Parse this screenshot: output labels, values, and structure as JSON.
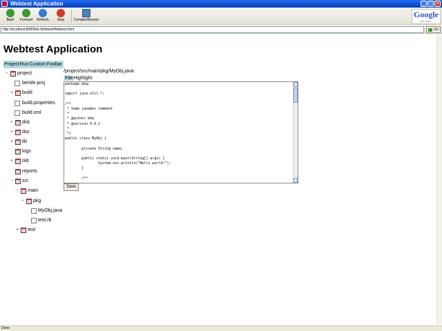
{
  "window": {
    "title": "Webtest Application"
  },
  "toolbar": {
    "back": "Back",
    "forward": "Forward",
    "refresh": "Refresh",
    "stop": "Stop",
    "compile": "Compile/Browse"
  },
  "google": {
    "logo": "Google",
    "sub": "Web Search"
  },
  "address": {
    "url": "http://localhost:8080/ide.Webtest/Webtest.html",
    "go": "Go"
  },
  "page": {
    "title": "Webtest Application",
    "menu": [
      "Project",
      "Run",
      "Custom",
      "Foobar"
    ]
  },
  "tree": [
    {
      "label": "project",
      "icon": "folder-icon",
      "toggle": "−"
    },
    {
      "label": "beride.proj",
      "icon": "file-icon",
      "toggle": ""
    },
    {
      "label": "build",
      "icon": "folder-icon",
      "toggle": "+"
    },
    {
      "label": "build.properties",
      "icon": "file-icon",
      "toggle": ""
    },
    {
      "label": "build.xml",
      "icon": "file-icon",
      "toggle": ""
    },
    {
      "label": "dist",
      "icon": "folder-icon",
      "toggle": "+"
    },
    {
      "label": "doc",
      "icon": "folder-icon",
      "toggle": "+"
    },
    {
      "label": "lib",
      "icon": "folder-icon",
      "toggle": "+"
    },
    {
      "label": "logs",
      "icon": "folder-icon",
      "toggle": ""
    },
    {
      "label": "old",
      "icon": "folder-icon",
      "toggle": "+"
    },
    {
      "label": "reports",
      "icon": "folder-icon",
      "toggle": ""
    },
    {
      "label": "src",
      "icon": "folder-icon",
      "toggle": "−"
    },
    {
      "label": "main",
      "icon": "folder-icon",
      "toggle": "−"
    },
    {
      "label": "pkg",
      "icon": "folder-icon",
      "toggle": "−"
    },
    {
      "label": "MyObj.java",
      "icon": "file-icon",
      "toggle": ""
    },
    {
      "label": "test.rb",
      "icon": "file-icon",
      "toggle": ""
    },
    {
      "label": "test",
      "icon": "folder-icon",
      "toggle": "+"
    }
  ],
  "editor": {
    "path": "/project/src/main/pkg/MyObj.java",
    "tab_file": "File",
    "tab_highlight": "Highlight",
    "code": "package pkg;\n\nimport java.util.*;\n\n/**\n * Some javadoc comment\n *\n * @author bbw\n * @version 0.0.1\n *\n */\npublic class MyObj {\n\n        private String name;\n\n        public static void main(String[] args) {\n                System.out.println(\"Hello world!\");\n        }\n\n        /**",
    "save": "Save"
  },
  "status": {
    "text": "Done"
  },
  "colors": {
    "menu_bg": "#b3dbe6",
    "title_bar": "#0a4fd6"
  }
}
